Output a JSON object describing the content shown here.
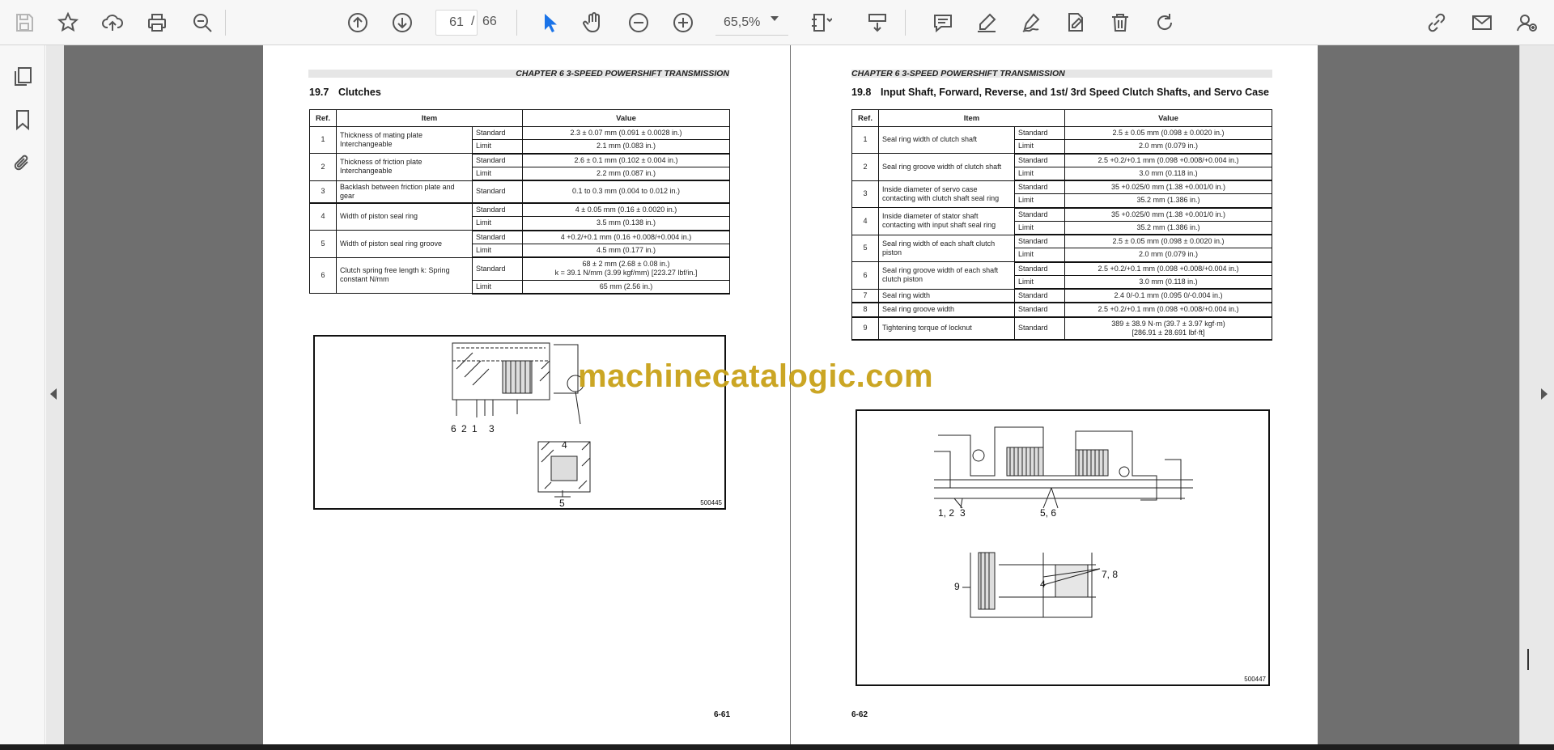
{
  "toolbar": {
    "current_page": "61",
    "separator": "/",
    "total_pages": "66",
    "zoom": "65,5%"
  },
  "colors": {
    "accent": "#1a73e8",
    "page_bg": "#ffffff",
    "viewer_bg": "#6f6f6f",
    "watermark": "#c9a219"
  },
  "icons": {
    "toolbar": [
      "save-icon",
      "bookmark-star-icon",
      "upload-cloud-icon",
      "print-icon",
      "zoom-search-icon",
      "page-up-icon",
      "page-down-icon",
      "select-cursor-icon",
      "hand-tool-icon",
      "zoom-out-icon",
      "zoom-in-icon",
      "fit-page-icon",
      "scroll-mode-icon",
      "comment-icon",
      "highlight-pen-icon",
      "draw-sign-icon",
      "export-edit-icon",
      "delete-icon",
      "rotate-icon",
      "share-link-icon",
      "email-icon",
      "add-user-icon"
    ],
    "sidebar": [
      "page-thumbnails-icon",
      "bookmarks-icon",
      "attachments-icon"
    ]
  },
  "left_page": {
    "chapter": "CHAPTER 6 3-SPEED POWERSHIFT TRANSMISSION",
    "section_num": "19.7",
    "section_title": "Clutches",
    "headers": {
      "ref": "Ref.",
      "item": "Item",
      "value": "Value"
    },
    "rows": [
      {
        "ref": "1",
        "item": "Thickness of mating plate Interchangeable",
        "std_label": "Standard",
        "std": "2.3 ± 0.07 mm (0.091 ± 0.0028 in.)",
        "lim_label": "Limit",
        "lim": "2.1 mm (0.083 in.)"
      },
      {
        "ref": "2",
        "item": "Thickness of friction plate Interchangeable",
        "std_label": "Standard",
        "std": "2.6 ± 0.1 mm (0.102 ± 0.004 in.)",
        "lim_label": "Limit",
        "lim": "2.2 mm (0.087 in.)"
      },
      {
        "ref": "3",
        "item": "Backlash between friction plate and gear",
        "std_label": "Standard",
        "std": "0.1 to 0.3 mm (0.004 to 0.012 in.)"
      },
      {
        "ref": "4",
        "item": "Width of piston seal ring",
        "std_label": "Standard",
        "std": "4 ± 0.05 mm (0.16 ± 0.0020 in.)",
        "lim_label": "Limit",
        "lim": "3.5 mm (0.138 in.)"
      },
      {
        "ref": "5",
        "item": "Width of piston seal ring groove",
        "std_label": "Standard",
        "std": "4 +0.2/+0.1 mm (0.16 +0.008/+0.004 in.)",
        "lim_label": "Limit",
        "lim": "4.5 mm (0.177 in.)"
      },
      {
        "ref": "6",
        "item": "Clutch spring free length k: Spring constant N/mm",
        "std_label": "Standard",
        "std": "68 ± 2 mm (2.68 ± 0.08 in.)",
        "std2": "k = 39.1 N/mm (3.99 kgf/mm) [223.27 lbf/in.]",
        "lim_label": "Limit",
        "lim": "65 mm (2.56 in.)"
      }
    ],
    "figure": {
      "code": "500445",
      "callouts": [
        "6",
        "2",
        "1",
        "3",
        "4",
        "5"
      ]
    },
    "page_number": "6-61"
  },
  "right_page": {
    "chapter": "CHAPTER 6 3-SPEED POWERSHIFT TRANSMISSION",
    "section_num": "19.8",
    "section_title": "Input Shaft, Forward, Reverse, and 1st/ 3rd Speed Clutch Shafts, and Servo Case",
    "headers": {
      "ref": "Ref.",
      "item": "Item",
      "value": "Value"
    },
    "rows": [
      {
        "ref": "1",
        "item": "Seal ring width of clutch shaft",
        "std_label": "Standard",
        "std": "2.5 ± 0.05 mm (0.098 ± 0.0020 in.)",
        "lim_label": "Limit",
        "lim": "2.0 mm (0.079 in.)"
      },
      {
        "ref": "2",
        "item": "Seal ring groove width of clutch shaft",
        "std_label": "Standard",
        "std": "2.5 +0.2/+0.1 mm (0.098 +0.008/+0.004 in.)",
        "lim_label": "Limit",
        "lim": "3.0 mm (0.118 in.)"
      },
      {
        "ref": "3",
        "item": "Inside diameter of servo case contacting with clutch shaft seal ring",
        "std_label": "Standard",
        "std": "35 +0.025/0 mm (1.38 +0.001/0 in.)",
        "lim_label": "Limit",
        "lim": "35.2 mm (1.386 in.)"
      },
      {
        "ref": "4",
        "item": "Inside diameter of stator shaft contacting with input shaft seal ring",
        "std_label": "Standard",
        "std": "35 +0.025/0 mm (1.38 +0.001/0 in.)",
        "lim_label": "Limit",
        "lim": "35.2 mm (1.386 in.)"
      },
      {
        "ref": "5",
        "item": "Seal ring width of each shaft clutch piston",
        "std_label": "Standard",
        "std": "2.5 ± 0.05 mm (0.098 ± 0.0020 in.)",
        "lim_label": "Limit",
        "lim": "2.0 mm (0.079 in.)"
      },
      {
        "ref": "6",
        "item": "Seal ring groove width of each shaft clutch piston",
        "std_label": "Standard",
        "std": "2.5 +0.2/+0.1 mm (0.098 +0.008/+0.004 in.)",
        "lim_label": "Limit",
        "lim": "3.0 mm (0.118 in.)"
      },
      {
        "ref": "7",
        "item": "Seal ring width",
        "std_label": "Standard",
        "std": "2.4 0/-0.1 mm (0.095 0/-0.004 in.)"
      },
      {
        "ref": "8",
        "item": "Seal ring groove width",
        "std_label": "Standard",
        "std": "2.5 +0.2/+0.1 mm (0.098 +0.008/+0.004 in.)"
      },
      {
        "ref": "9",
        "item": "Tightening torque of locknut",
        "std_label": "Standard",
        "std": "389 ± 38.9 N·m (39.7 ± 3.97 kgf·m)",
        "std2": "[286.91 ± 28.691 lbf·ft]"
      }
    ],
    "figure": {
      "code": "500447",
      "callouts": [
        "1, 2",
        "3",
        "5, 6",
        "7, 8",
        "4",
        "9"
      ]
    },
    "page_number": "6-62"
  },
  "watermark": "machinecatalogic.com"
}
